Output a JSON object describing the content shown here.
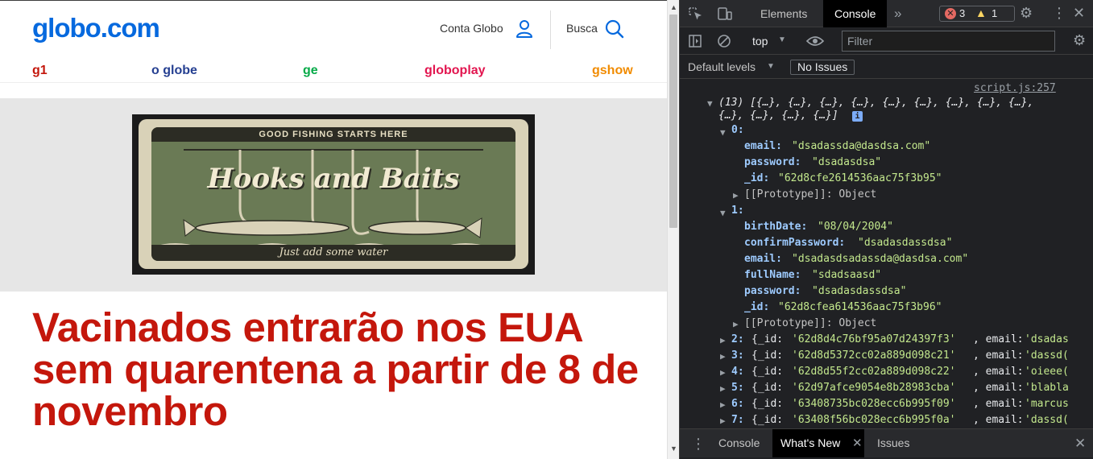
{
  "page": {
    "logo": "globo.com",
    "account_label": "Conta Globo",
    "search_label": "Busca",
    "nav": [
      {
        "label": "g1",
        "color": "#c4170c"
      },
      {
        "label": "o globe",
        "color": "#253f91"
      },
      {
        "label": "ge",
        "color": "#06aa48"
      },
      {
        "label": "globoplay",
        "color": "#e2154f"
      },
      {
        "label": "gshow",
        "color": "#f18b00"
      }
    ],
    "ad": {
      "top_text": "GOOD FISHING STARTS HERE",
      "title": "Hooks and Baits",
      "bottom_text": "Just add some water"
    },
    "headline": "Vacinados entrarão nos EUA sem quarentena a partir de 8 de novembro"
  },
  "devtools": {
    "tabs": [
      "Elements",
      "Console"
    ],
    "active_tab": "Console",
    "errors": "3",
    "warnings": "1",
    "context": "top",
    "filter_placeholder": "Filter",
    "levels": "Default levels",
    "issues": "No Issues",
    "source": "script.js:257",
    "array_summary": "(13) [{…}, {…}, {…}, {…}, {…}, {…}, {…}, {…}, {…},",
    "array_summary_2": "{…}, {…}, {…}, {…}]",
    "item0": {
      "index": "0:",
      "email": "\"dsadassda@dasdsa.com\"",
      "password": "\"dsadasdsa\"",
      "_id": "\"62d8cfe2614536aac75f3b95\""
    },
    "item1": {
      "index": "1:",
      "birthDate": "\"08/04/2004\"",
      "confirmPassword": "\"dsadasdassdsa\"",
      "email": "\"dsadasdsadassda@dasdsa.com\"",
      "fullName": "\"sdadsaasd\"",
      "password": "\"dsadasdassdsa\"",
      "_id": "\"62d8cfea614536aac75f3b96\""
    },
    "prototype": "[[Prototype]]: Object",
    "collapsed": [
      {
        "index": "2:",
        "id": "'62d8d4c76bf95a07d24397f3'",
        "email": "'dsadas"
      },
      {
        "index": "3:",
        "id": "'62d8d5372cc02a889d098c21'",
        "email": "'dassd("
      },
      {
        "index": "4:",
        "id": "'62d8d55f2cc02a889d098c22'",
        "email": "'oieee("
      },
      {
        "index": "5:",
        "id": "'62d97afce9054e8b28983cba'",
        "email": "'blabla"
      },
      {
        "index": "6:",
        "id": "'63408735bc028ecc6b995f09'",
        "email": "'marcus"
      },
      {
        "index": "7:",
        "id": "'63408f56bc028ecc6b995f0a'",
        "email": "'dassd("
      }
    ],
    "drawer_tabs": [
      "Console",
      "What's New",
      "Issues"
    ]
  }
}
